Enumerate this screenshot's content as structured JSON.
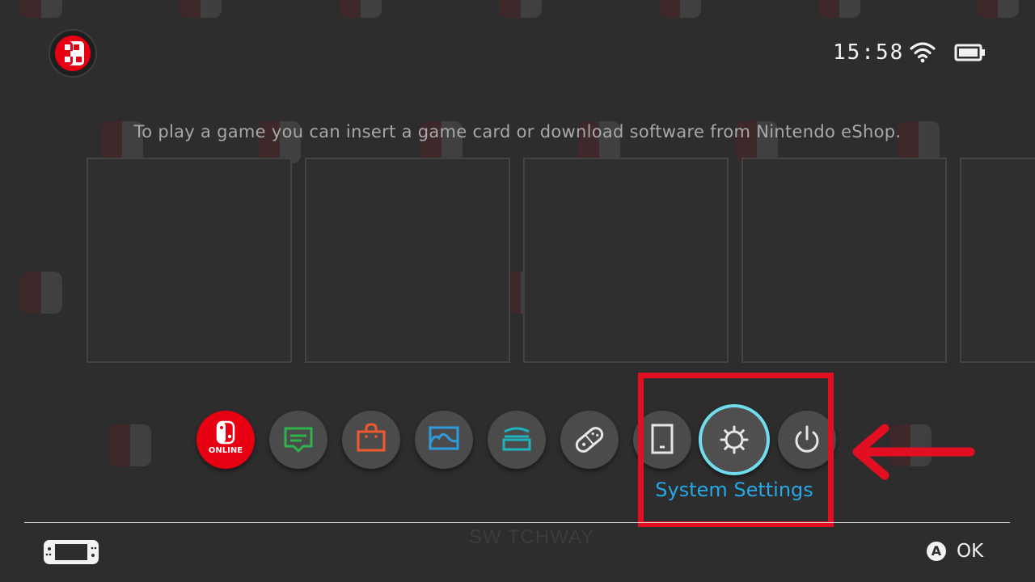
{
  "status_bar": {
    "time": "15:58",
    "wifi_icon": "wifi-icon",
    "battery_icon": "battery-icon"
  },
  "user": {
    "avatar_icon": "user-avatar-icon"
  },
  "home": {
    "hint": "To play a game you can insert a game card or download software from Nintendo eShop."
  },
  "dock": {
    "items": [
      {
        "name": "Nintendo Switch Online",
        "icon": "switch-online-icon",
        "color": "#e60012",
        "label": "ONLINE"
      },
      {
        "name": "News",
        "icon": "news-icon",
        "color": "#2fb34a"
      },
      {
        "name": "Nintendo eShop",
        "icon": "eshop-bag-icon",
        "color": "#f0582d"
      },
      {
        "name": "Album",
        "icon": "album-icon",
        "color": "#2f9bdc"
      },
      {
        "name": "Controllers",
        "icon": "controllers-icon",
        "color": "#1fb5bd"
      },
      {
        "name": "Joy-Con",
        "icon": "joycon-icon",
        "color": "#e6e6e6"
      },
      {
        "name": "Data Management",
        "icon": "tablet-icon",
        "color": "#e6e6e6"
      },
      {
        "name": "System Settings",
        "icon": "gear-icon",
        "color": "#e6e6e6"
      },
      {
        "name": "Power",
        "icon": "power-icon",
        "color": "#e6e6e6"
      }
    ],
    "selected_label": "System Settings"
  },
  "footer": {
    "console_icon": "console-icon",
    "watermark": "SW TCHWAY",
    "confirm_button": "A",
    "confirm_label": "OK"
  },
  "colors": {
    "background": "#2d2d2d",
    "selection_ring": "#70dced",
    "selection_text": "#26a7e6",
    "annotation_red": "#e20e22"
  }
}
